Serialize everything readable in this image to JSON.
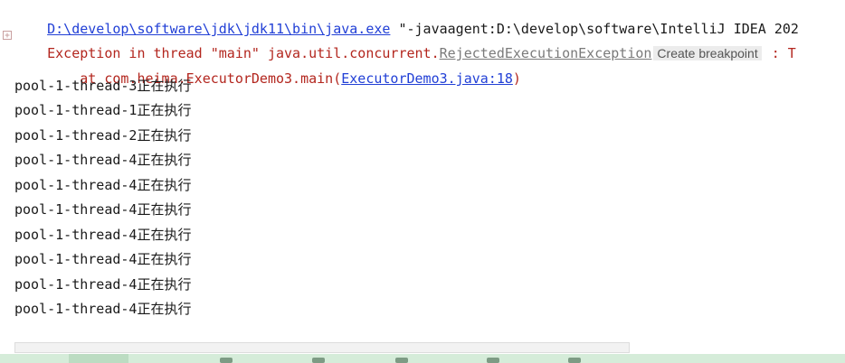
{
  "console": {
    "command": {
      "java_path": "D:\\develop\\software\\jdk\\jdk11\\bin\\java.exe",
      "args": " \"-javaagent:D:\\develop\\software\\IntelliJ IDEA 202"
    },
    "exception": {
      "prefix": "Exception in thread \"main\" java.util.concurrent.",
      "class_link": "RejectedExecutionException",
      "breakpoint_hint": "Create breakpoint",
      "suffix": " : T"
    },
    "stack": {
      "prefix": "    at com.heima.ExecutorDemo3.main(",
      "source_link": "ExecutorDemo3.java:18",
      "suffix": ")"
    },
    "output": [
      "pool-1-thread-3正在执行",
      "pool-1-thread-1正在执行",
      "pool-1-thread-2正在执行",
      "pool-1-thread-4正在执行",
      "pool-1-thread-4正在执行",
      "pool-1-thread-4正在执行",
      "pool-1-thread-4正在执行",
      "pool-1-thread-4正在执行",
      "pool-1-thread-4正在执行",
      "pool-1-thread-4正在执行"
    ]
  },
  "icons": {
    "gutter": "fold-icon"
  },
  "colors": {
    "link": "#2240d6",
    "error": "#b3261e",
    "statusbar": "#d5ecd9"
  }
}
